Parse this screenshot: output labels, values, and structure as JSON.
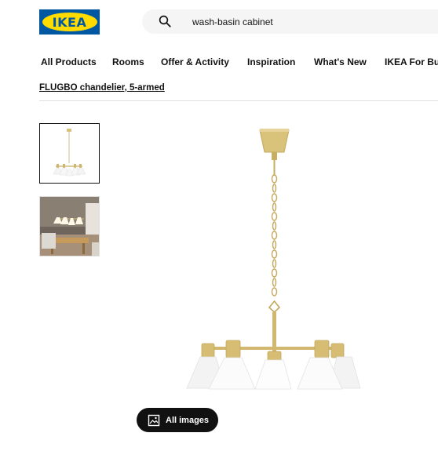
{
  "brand": {
    "logo_text": "IKEA"
  },
  "search": {
    "value": "wash-basin cabinet"
  },
  "nav": {
    "items": [
      {
        "label": "All Products"
      },
      {
        "label": "Rooms"
      },
      {
        "label": "Offer & Activity"
      },
      {
        "label": "Inspiration"
      },
      {
        "label": "What's New"
      },
      {
        "label": "IKEA For Bus"
      }
    ]
  },
  "breadcrumb": {
    "label": "FLUGBO chandelier, 5-armed"
  },
  "gallery": {
    "all_images_label": "All images"
  },
  "colors": {
    "brand_blue": "#0058a3",
    "brand_yellow": "#ffdb00",
    "brass": "#d9c27a",
    "button_dark": "#111111"
  }
}
